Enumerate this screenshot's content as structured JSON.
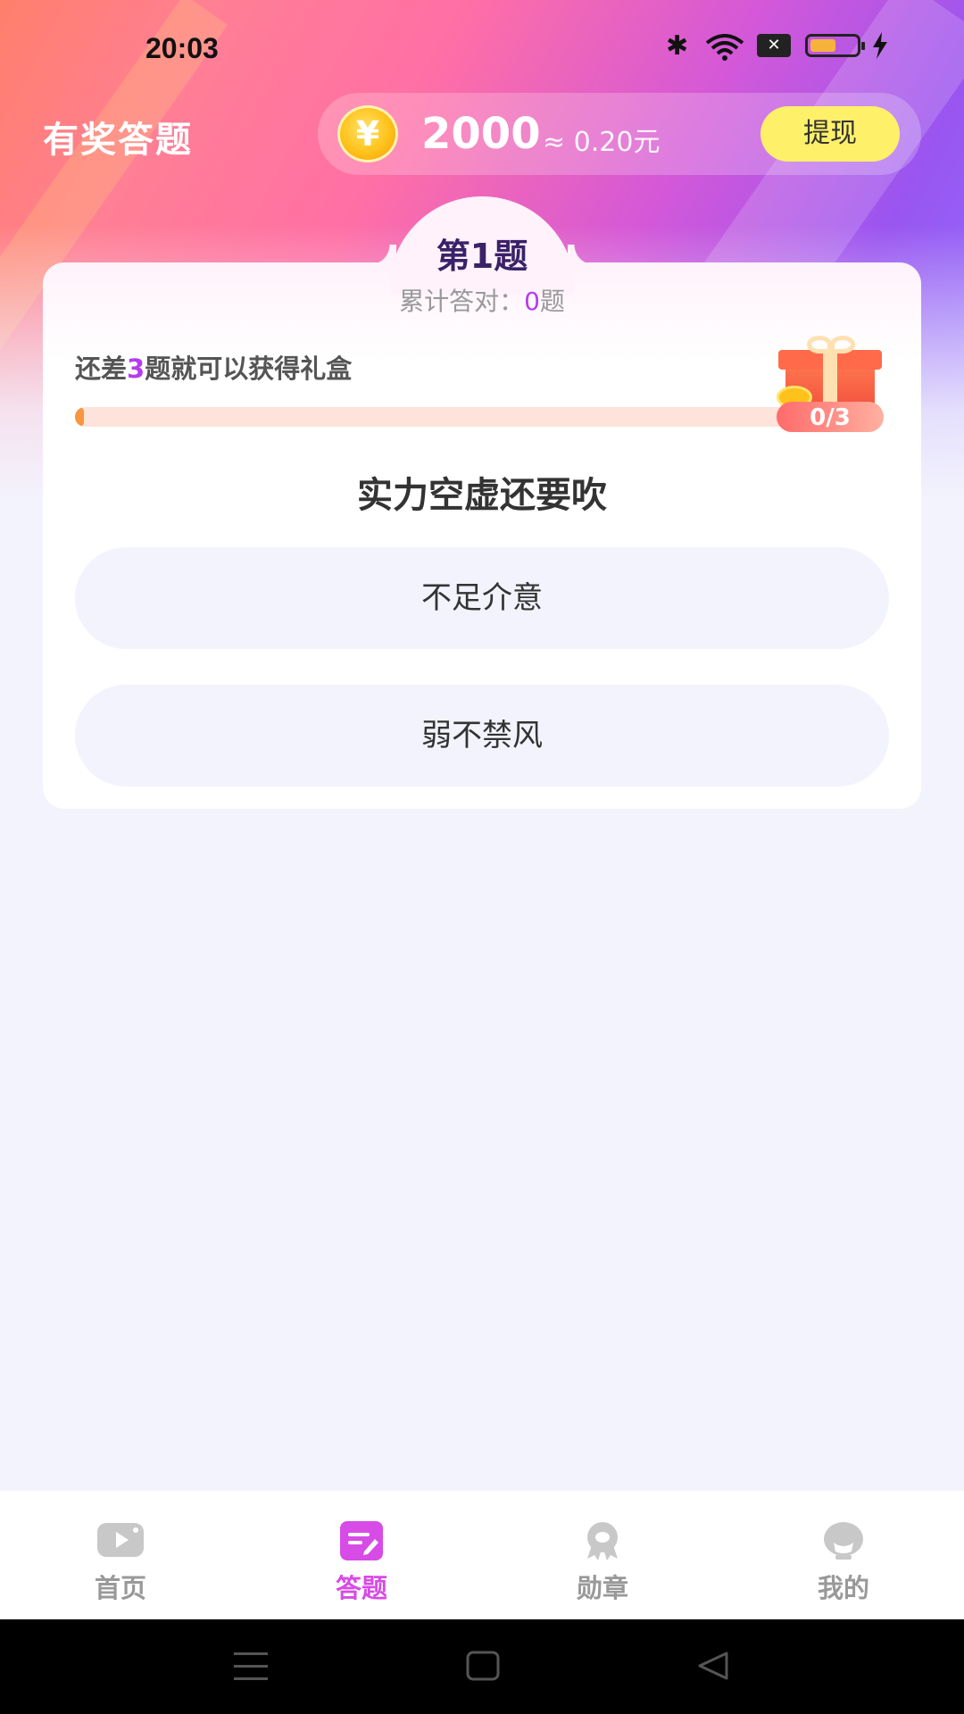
{
  "status_bar": {
    "time": "20:03",
    "icons": [
      "bluetooth-icon",
      "wifi-icon",
      "sim-icon",
      "battery-icon",
      "charging-icon"
    ],
    "sim_label": "✕",
    "battery_level": 0.55
  },
  "header": {
    "title": "有奖答题",
    "coin_icon_label": "¥",
    "coins": "2000",
    "approx_value": "≈ 0.20元",
    "withdraw_label": "提现"
  },
  "quiz": {
    "question_number": "第1题",
    "correct_prefix": "累计答对：",
    "correct_count": "0",
    "correct_suffix": "题",
    "gift_hint_prefix": "还差",
    "gift_hint_count": "3",
    "gift_hint_suffix": "题就可以获得礼盒",
    "progress_label": "0/3",
    "progress_value": 0,
    "question": "实力空虚还要吹",
    "options": [
      "不足介意",
      "弱不禁风"
    ]
  },
  "bottom_nav": {
    "items": [
      {
        "label": "首页",
        "icon": "home-video-icon",
        "active": false
      },
      {
        "label": "答题",
        "icon": "quiz-edit-icon",
        "active": true
      },
      {
        "label": "勋章",
        "icon": "medal-icon",
        "active": false
      },
      {
        "label": "我的",
        "icon": "profile-icon",
        "active": false
      }
    ]
  },
  "colors": {
    "accent": "#d74be6",
    "highlight": "#b53cf0",
    "withdraw_button": "#fff06a",
    "progress": "#f7963f"
  }
}
